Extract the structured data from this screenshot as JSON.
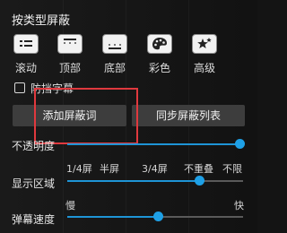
{
  "section_title": "按类型屏蔽",
  "block_types": [
    {
      "label": "滚动",
      "icon": "scroll-danmaku-icon"
    },
    {
      "label": "顶部",
      "icon": "top-danmaku-icon"
    },
    {
      "label": "底部",
      "icon": "bottom-danmaku-icon"
    },
    {
      "label": "彩色",
      "icon": "palette-icon"
    },
    {
      "label": "高级",
      "icon": "advanced-star-icon"
    }
  ],
  "prevent_subtitle": {
    "label": "防挡字幕",
    "checked": false
  },
  "buttons": {
    "add_block_word": "添加屏蔽词",
    "sync_block_list": "同步屏蔽列表"
  },
  "opacity": {
    "label": "不透明度",
    "value_fraction": 1.0
  },
  "display_area": {
    "label": "显示区域",
    "ticks": [
      "1/4屏",
      "半屏",
      "3/4屏",
      "不重叠",
      "不限"
    ],
    "selected": "不重叠"
  },
  "speed": {
    "label": "弹幕速度",
    "min_label": "慢",
    "max_label": "快",
    "value_fraction": 0.52
  },
  "colors": {
    "accent": "#1ea0e6",
    "highlight_box": "#e0393e",
    "button_bg": "#3d3d3d"
  }
}
